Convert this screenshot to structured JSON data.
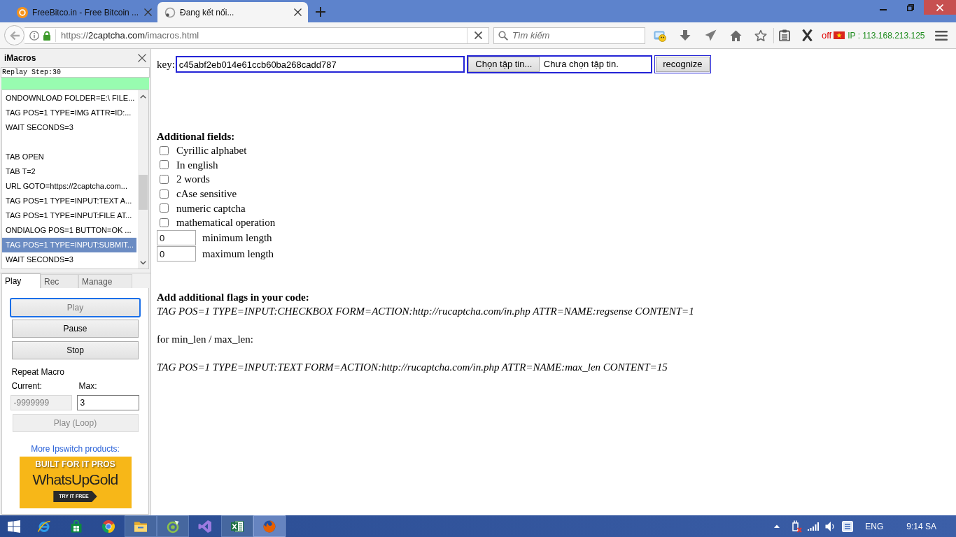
{
  "browser": {
    "tabs": [
      {
        "title": "FreeBitco.in - Free Bitcoin ...",
        "loading": false,
        "selected": false
      },
      {
        "title": "Đang kết nối...",
        "loading": true,
        "selected": true
      }
    ],
    "address_bar": {
      "scheme": "https://",
      "domain": "2captcha.com",
      "path": "/imacros.html"
    },
    "search": {
      "placeholder": "Tìm kiếm"
    },
    "toolbar": {
      "proxy_status": "off",
      "ip": "IP : 113.168.213.125"
    }
  },
  "imacros": {
    "title": "iMacros",
    "replay_status": "Replay Step:30",
    "macro_lines": [
      {
        "kind": "command",
        "text": "ONDOWNLOAD FOLDER=E:\\ FILE...",
        "selected": false
      },
      {
        "kind": "command",
        "text": "TAG POS=1 TYPE=IMG ATTR=ID:...",
        "selected": false
      },
      {
        "kind": "command",
        "text": "WAIT SECONDS=3",
        "selected": false
      },
      {
        "kind": "blank",
        "selected": false
      },
      {
        "kind": "command",
        "text": "TAB OPEN",
        "selected": false
      },
      {
        "kind": "command",
        "text": "TAB T=2",
        "selected": false
      },
      {
        "kind": "command",
        "text": "URL GOTO=https://2captcha.com...",
        "selected": false
      },
      {
        "kind": "command",
        "text": "TAG POS=1 TYPE=INPUT:TEXT A...",
        "selected": false
      },
      {
        "kind": "command",
        "text": "TAG POS=1 TYPE=INPUT:FILE AT...",
        "selected": false
      },
      {
        "kind": "command",
        "text": "ONDIALOG POS=1 BUTTON=OK ...",
        "selected": false
      },
      {
        "kind": "command",
        "text": "TAG POS=1 TYPE=INPUT:SUBMIT...",
        "selected": true
      },
      {
        "kind": "command",
        "text": "WAIT SECONDS=3",
        "selected": false
      }
    ],
    "tabs": [
      {
        "label": "Play",
        "selected": true
      },
      {
        "label": "Rec",
        "selected": false
      },
      {
        "label": "Manage",
        "selected": false
      }
    ],
    "buttons": [
      {
        "label": "Play",
        "disabled": true,
        "focused": true
      },
      {
        "label": "Pause",
        "disabled": false,
        "focused": false
      },
      {
        "label": "Stop",
        "disabled": false,
        "focused": false
      }
    ],
    "repeat": {
      "title": "Repeat Macro",
      "fields": [
        {
          "label": "Current:",
          "value": "-9999999",
          "disabled": true
        },
        {
          "label": "Max:",
          "value": "3",
          "disabled": false
        }
      ],
      "loop_button": {
        "label": "Play (Loop)",
        "disabled": true
      }
    },
    "promo": {
      "link": "More Ipswitch products:",
      "headline": "BUILT FOR IT PROS",
      "brand": "WhatsUpGold",
      "cta": "TRY IT FREE"
    }
  },
  "page": {
    "key": {
      "label": "key:",
      "value": "c45abf2eb014e61ccb60ba268cadd787"
    },
    "file_picker": {
      "button": "Chọn tập tin...",
      "status": "Chưa chọn tập tin."
    },
    "submit": "recognize",
    "fields_heading": "Additional fields:",
    "options": [
      {
        "label": "Cyrillic alphabet",
        "checked": false
      },
      {
        "label": "In english",
        "checked": false
      },
      {
        "label": "2 words",
        "checked": false
      },
      {
        "label": "cAse sensitive",
        "checked": false
      },
      {
        "label": "numeric captcha",
        "checked": false
      },
      {
        "label": "mathematical operation",
        "checked": false
      }
    ],
    "lengths": [
      {
        "value": "0",
        "label": "minimum length"
      },
      {
        "value": "0",
        "label": "maximum length"
      }
    ],
    "flags_heading": "Add additional flags in your code:",
    "paragraphs": [
      {
        "kind": "code",
        "text": "TAG POS=1 TYPE=INPUT:CHECKBOX FORM=ACTION:http://rucaptcha.com/in.php ATTR=NAME:regsense CONTENT=1"
      },
      {
        "kind": "plain",
        "text": "for min_len / max_len:"
      },
      {
        "kind": "code",
        "text": "TAG POS=1 TYPE=INPUT:TEXT FORM=ACTION:http://rucaptcha.com/in.php ATTR=NAME:max_len CONTENT=15"
      }
    ]
  },
  "taskbar": {
    "apps": [
      {
        "kind": "orbit",
        "running": false,
        "active": false
      },
      {
        "kind": "store",
        "running": false,
        "active": false
      },
      {
        "kind": "segments",
        "running": false,
        "active": false
      },
      {
        "kind": "folder",
        "running": true,
        "active": false
      },
      {
        "kind": "ring",
        "running": true,
        "active": false
      },
      {
        "kind": "ribbon",
        "running": false,
        "active": false
      },
      {
        "kind": "sheet",
        "running": true,
        "active": false
      },
      {
        "kind": "globe",
        "running": true,
        "active": true
      }
    ],
    "tray": {
      "language": "ENG",
      "time": "9:14 SA"
    }
  }
}
